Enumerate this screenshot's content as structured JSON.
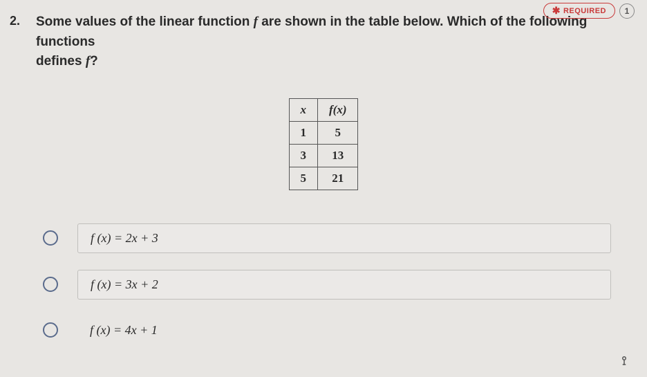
{
  "header": {
    "required_label": "REQUIRED",
    "points": "1"
  },
  "question": {
    "number": "2.",
    "text_prefix": "Some values of the linear function ",
    "func_symbol": "f",
    "text_mid": " are shown in the table below. Which of the following functions",
    "text_line2": "defines ",
    "func_symbol2": "f",
    "text_suffix": "?"
  },
  "chart_data": {
    "type": "table",
    "columns": [
      "x",
      "f(x)"
    ],
    "rows": [
      {
        "x": "1",
        "fx": "5"
      },
      {
        "x": "3",
        "fx": "13"
      },
      {
        "x": "5",
        "fx": "21"
      }
    ]
  },
  "options": [
    {
      "formula": "f (x) = 2x + 3"
    },
    {
      "formula": "f (x) = 3x + 2"
    },
    {
      "formula": "f (x) = 4x + 1"
    }
  ]
}
